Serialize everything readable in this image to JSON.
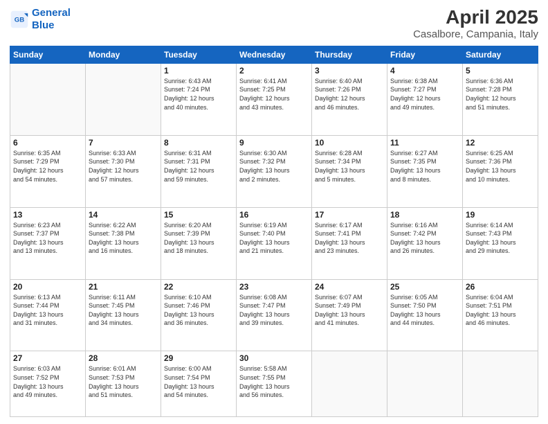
{
  "header": {
    "logo_line1": "General",
    "logo_line2": "Blue",
    "month_year": "April 2025",
    "location": "Casalbore, Campania, Italy"
  },
  "weekdays": [
    "Sunday",
    "Monday",
    "Tuesday",
    "Wednesday",
    "Thursday",
    "Friday",
    "Saturday"
  ],
  "weeks": [
    [
      {
        "day": "",
        "info": ""
      },
      {
        "day": "",
        "info": ""
      },
      {
        "day": "1",
        "info": "Sunrise: 6:43 AM\nSunset: 7:24 PM\nDaylight: 12 hours\nand 40 minutes."
      },
      {
        "day": "2",
        "info": "Sunrise: 6:41 AM\nSunset: 7:25 PM\nDaylight: 12 hours\nand 43 minutes."
      },
      {
        "day": "3",
        "info": "Sunrise: 6:40 AM\nSunset: 7:26 PM\nDaylight: 12 hours\nand 46 minutes."
      },
      {
        "day": "4",
        "info": "Sunrise: 6:38 AM\nSunset: 7:27 PM\nDaylight: 12 hours\nand 49 minutes."
      },
      {
        "day": "5",
        "info": "Sunrise: 6:36 AM\nSunset: 7:28 PM\nDaylight: 12 hours\nand 51 minutes."
      }
    ],
    [
      {
        "day": "6",
        "info": "Sunrise: 6:35 AM\nSunset: 7:29 PM\nDaylight: 12 hours\nand 54 minutes."
      },
      {
        "day": "7",
        "info": "Sunrise: 6:33 AM\nSunset: 7:30 PM\nDaylight: 12 hours\nand 57 minutes."
      },
      {
        "day": "8",
        "info": "Sunrise: 6:31 AM\nSunset: 7:31 PM\nDaylight: 12 hours\nand 59 minutes."
      },
      {
        "day": "9",
        "info": "Sunrise: 6:30 AM\nSunset: 7:32 PM\nDaylight: 13 hours\nand 2 minutes."
      },
      {
        "day": "10",
        "info": "Sunrise: 6:28 AM\nSunset: 7:34 PM\nDaylight: 13 hours\nand 5 minutes."
      },
      {
        "day": "11",
        "info": "Sunrise: 6:27 AM\nSunset: 7:35 PM\nDaylight: 13 hours\nand 8 minutes."
      },
      {
        "day": "12",
        "info": "Sunrise: 6:25 AM\nSunset: 7:36 PM\nDaylight: 13 hours\nand 10 minutes."
      }
    ],
    [
      {
        "day": "13",
        "info": "Sunrise: 6:23 AM\nSunset: 7:37 PM\nDaylight: 13 hours\nand 13 minutes."
      },
      {
        "day": "14",
        "info": "Sunrise: 6:22 AM\nSunset: 7:38 PM\nDaylight: 13 hours\nand 16 minutes."
      },
      {
        "day": "15",
        "info": "Sunrise: 6:20 AM\nSunset: 7:39 PM\nDaylight: 13 hours\nand 18 minutes."
      },
      {
        "day": "16",
        "info": "Sunrise: 6:19 AM\nSunset: 7:40 PM\nDaylight: 13 hours\nand 21 minutes."
      },
      {
        "day": "17",
        "info": "Sunrise: 6:17 AM\nSunset: 7:41 PM\nDaylight: 13 hours\nand 23 minutes."
      },
      {
        "day": "18",
        "info": "Sunrise: 6:16 AM\nSunset: 7:42 PM\nDaylight: 13 hours\nand 26 minutes."
      },
      {
        "day": "19",
        "info": "Sunrise: 6:14 AM\nSunset: 7:43 PM\nDaylight: 13 hours\nand 29 minutes."
      }
    ],
    [
      {
        "day": "20",
        "info": "Sunrise: 6:13 AM\nSunset: 7:44 PM\nDaylight: 13 hours\nand 31 minutes."
      },
      {
        "day": "21",
        "info": "Sunrise: 6:11 AM\nSunset: 7:45 PM\nDaylight: 13 hours\nand 34 minutes."
      },
      {
        "day": "22",
        "info": "Sunrise: 6:10 AM\nSunset: 7:46 PM\nDaylight: 13 hours\nand 36 minutes."
      },
      {
        "day": "23",
        "info": "Sunrise: 6:08 AM\nSunset: 7:47 PM\nDaylight: 13 hours\nand 39 minutes."
      },
      {
        "day": "24",
        "info": "Sunrise: 6:07 AM\nSunset: 7:49 PM\nDaylight: 13 hours\nand 41 minutes."
      },
      {
        "day": "25",
        "info": "Sunrise: 6:05 AM\nSunset: 7:50 PM\nDaylight: 13 hours\nand 44 minutes."
      },
      {
        "day": "26",
        "info": "Sunrise: 6:04 AM\nSunset: 7:51 PM\nDaylight: 13 hours\nand 46 minutes."
      }
    ],
    [
      {
        "day": "27",
        "info": "Sunrise: 6:03 AM\nSunset: 7:52 PM\nDaylight: 13 hours\nand 49 minutes."
      },
      {
        "day": "28",
        "info": "Sunrise: 6:01 AM\nSunset: 7:53 PM\nDaylight: 13 hours\nand 51 minutes."
      },
      {
        "day": "29",
        "info": "Sunrise: 6:00 AM\nSunset: 7:54 PM\nDaylight: 13 hours\nand 54 minutes."
      },
      {
        "day": "30",
        "info": "Sunrise: 5:58 AM\nSunset: 7:55 PM\nDaylight: 13 hours\nand 56 minutes."
      },
      {
        "day": "",
        "info": ""
      },
      {
        "day": "",
        "info": ""
      },
      {
        "day": "",
        "info": ""
      }
    ]
  ]
}
